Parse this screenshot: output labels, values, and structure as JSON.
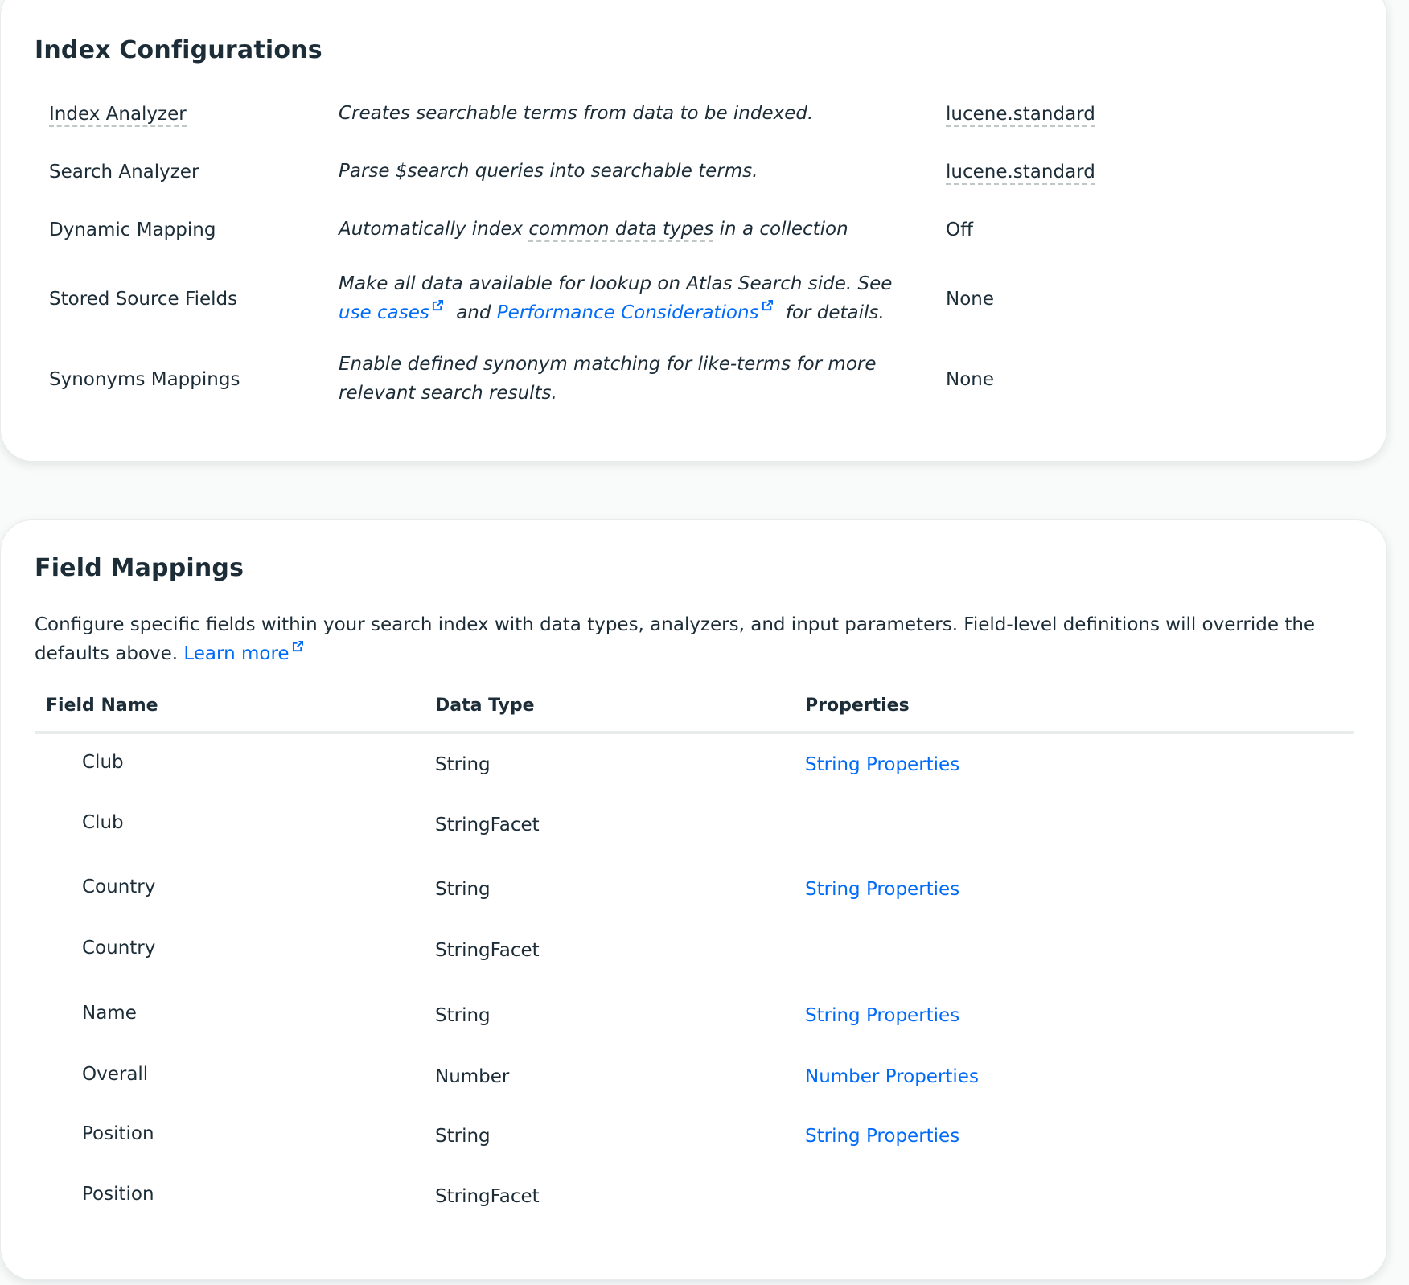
{
  "index_configurations": {
    "title": "Index Configurations",
    "rows": [
      {
        "label": "Index Analyzer",
        "description": "Creates searchable terms from data to be indexed.",
        "value": "lucene.standard"
      },
      {
        "label": "Search Analyzer",
        "description": "Parse $search queries into searchable terms.",
        "value": "lucene.standard"
      },
      {
        "label": "Dynamic Mapping",
        "description_before": "Automatically index ",
        "description_link": "common data types",
        "description_after": " in a collection",
        "value": "Off"
      },
      {
        "label": "Stored Source Fields",
        "description_before": "Make all data available for lookup on Atlas Search side. See ",
        "description_link1": "use cases",
        "description_mid": " and ",
        "description_link2": "Performance Considerations",
        "description_after": " for details.",
        "value": "None"
      },
      {
        "label": "Synonyms Mappings",
        "description": "Enable defined synonym matching for like-terms for more relevant search results.",
        "value": "None"
      }
    ]
  },
  "field_mappings": {
    "title": "Field Mappings",
    "description": "Configure specific fields within your search index with data types, analyzers, and input parameters. Field-level definitions will override the defaults above.",
    "learn_more": "Learn more",
    "columns": [
      "Field Name",
      "Data Type",
      "Properties"
    ],
    "rows": [
      {
        "name": "Club",
        "type": "String",
        "properties": "String Properties"
      },
      {
        "name": "Club",
        "type": "StringFacet",
        "properties": ""
      },
      {
        "name": "Country",
        "type": "String",
        "properties": "String Properties"
      },
      {
        "name": "Country",
        "type": "StringFacet",
        "properties": ""
      },
      {
        "name": "Name",
        "type": "String",
        "properties": "String Properties"
      },
      {
        "name": "Overall",
        "type": "Number",
        "properties": "Number Properties"
      },
      {
        "name": "Position",
        "type": "String",
        "properties": "String Properties"
      },
      {
        "name": "Position",
        "type": "StringFacet",
        "properties": ""
      }
    ]
  },
  "colors": {
    "link": "#016bf8",
    "text": "#1c2d38",
    "divider": "#e8edeb"
  },
  "icons": {
    "external_link": "external-link-icon"
  }
}
